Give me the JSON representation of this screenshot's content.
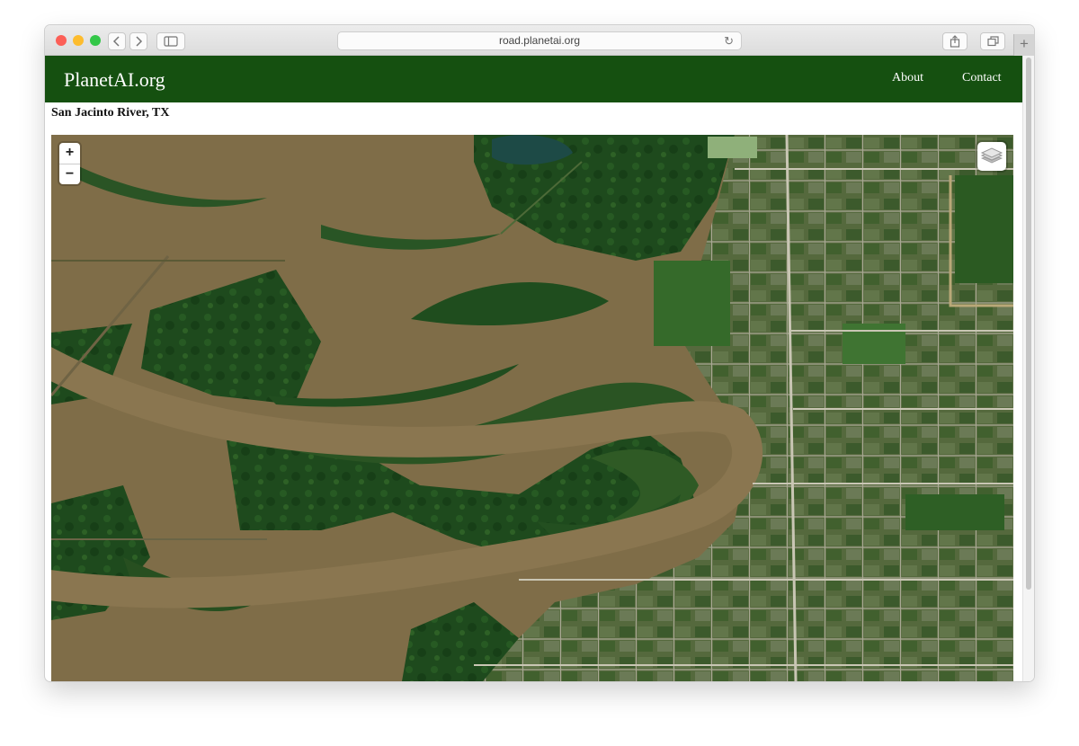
{
  "browser": {
    "url": "road.planetai.org",
    "traffic_lights": [
      "#fc5f57",
      "#fdbc2e",
      "#33c748"
    ],
    "back_icon": "chevron-left-icon",
    "forward_icon": "chevron-right-icon",
    "sidebar_icon": "sidebar-icon",
    "reload_icon": "reload-icon",
    "share_icon": "share-icon",
    "tabs_icon": "tabs-icon",
    "new_tab_icon": "plus-icon"
  },
  "site": {
    "brand": "PlanetAI.org",
    "nav": [
      "About",
      "Contact"
    ],
    "nav_color": "#155010"
  },
  "page": {
    "location_title": "San Jacinto River, TX"
  },
  "map": {
    "zoom_in": "+",
    "zoom_out": "−",
    "layer_control_icon": "layers-icon",
    "imagery": "satellite",
    "colors": {
      "floodwater": "#7f6d48",
      "vegetation": "#1f4a1e",
      "urban": "#566a3f",
      "roads": "#c9c6b4"
    }
  }
}
